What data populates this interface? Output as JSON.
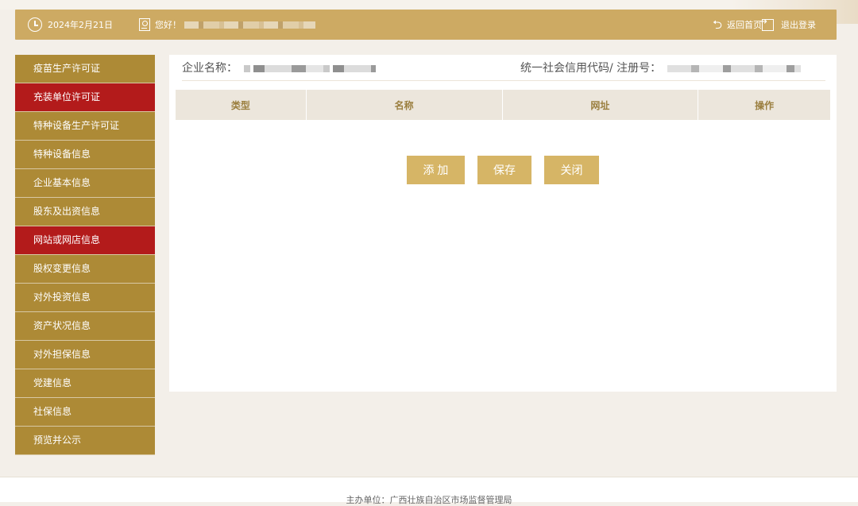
{
  "header": {
    "date": "2024年2月21日",
    "greeting": "您好！",
    "home_label": "返回首页",
    "logout_label": "退出登录"
  },
  "sidebar": {
    "items": [
      {
        "label": "疫苗生产许可证",
        "active": false
      },
      {
        "label": "充装单位许可证",
        "active": true
      },
      {
        "label": "特种设备生产许可证",
        "active": false
      },
      {
        "label": "特种设备信息",
        "active": false
      },
      {
        "label": "企业基本信息",
        "active": false
      },
      {
        "label": "股东及出资信息",
        "active": false
      },
      {
        "label": "网站或网店信息",
        "active": true
      },
      {
        "label": "股权变更信息",
        "active": false
      },
      {
        "label": "对外投资信息",
        "active": false
      },
      {
        "label": "资产状况信息",
        "active": false
      },
      {
        "label": "对外担保信息",
        "active": false
      },
      {
        "label": "党建信息",
        "active": false
      },
      {
        "label": "社保信息",
        "active": false
      },
      {
        "label": "预览并公示",
        "active": false
      }
    ]
  },
  "main": {
    "company_label": "企业名称：",
    "credit_label": "统一社会信用代码/ 注册号：",
    "table": {
      "columns": [
        "类型",
        "名称",
        "网址",
        "操作"
      ],
      "rows": []
    },
    "buttons": {
      "add": "添 加",
      "save": "保存",
      "close": "关闭"
    }
  },
  "footer": {
    "text": "主办单位：广西壮族自治区市场监督管理局"
  },
  "colors": {
    "header": "#cdaa63",
    "sidebar": "#ad8a36",
    "active": "#b31b1b",
    "button": "#d6b566"
  }
}
